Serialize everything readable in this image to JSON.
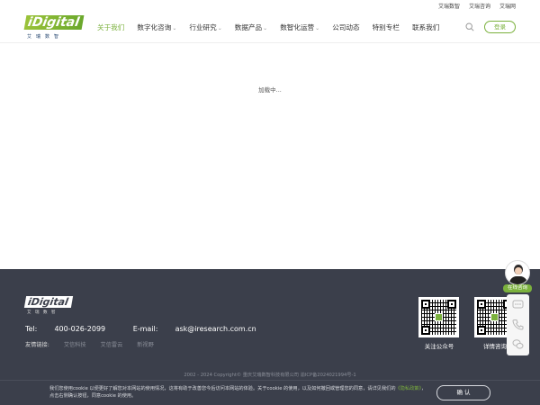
{
  "topbar": {
    "links": [
      "艾瑞数智",
      "艾瑞咨询",
      "艾瑞网"
    ]
  },
  "brand": {
    "logo_text": "iDigital",
    "logo_sub": "艾瑞数智",
    "accent_color": "#7bb13d",
    "footer_bg": "#3b3f4b"
  },
  "nav": {
    "items": [
      {
        "label": "关于我们",
        "active": true,
        "dropdown": false
      },
      {
        "label": "数字化咨询",
        "active": false,
        "dropdown": true
      },
      {
        "label": "行业研究",
        "active": false,
        "dropdown": true
      },
      {
        "label": "数据产品",
        "active": false,
        "dropdown": true
      },
      {
        "label": "数智化运营",
        "active": false,
        "dropdown": true
      },
      {
        "label": "公司动态",
        "active": false,
        "dropdown": false
      },
      {
        "label": "特别专栏",
        "active": false,
        "dropdown": false
      },
      {
        "label": "联系我们",
        "active": false,
        "dropdown": false
      }
    ],
    "search_icon": "search-icon",
    "login_label": "登录"
  },
  "main": {
    "loading_text": "加载中..."
  },
  "footer": {
    "tel_label": "Tel:",
    "tel": "400-026-2099",
    "email_label": "E-mail:",
    "email": "ask@iresearch.com.cn",
    "links_label": "友情链接:",
    "links": [
      "艾信科技",
      "艾信雷云",
      "新视野"
    ],
    "qr": [
      {
        "caption": "关注公众号"
      },
      {
        "caption": "详情咨询"
      }
    ],
    "copyright": "2002 - 2024 Copyright© 重庆艾瑞数智科技有限公司  渝ICP备2024021994号-1"
  },
  "cookie": {
    "text_before": "我们您使用cookie 以便更好了解您对本网站的使用情况，这将有助于改善您今后访问本网站的体验。关于cookie 的使用，以及如何撤回或管理您的同意，请详见我们的",
    "policy_link": "《隐私政策》",
    "text_after": "，点击右侧确认按钮，同意cookie 的使用。",
    "ok_label": "确 认"
  },
  "side": {
    "chat_label": "在线咨询",
    "buttons": [
      "message-icon",
      "phone-icon",
      "wechat-icon"
    ]
  }
}
